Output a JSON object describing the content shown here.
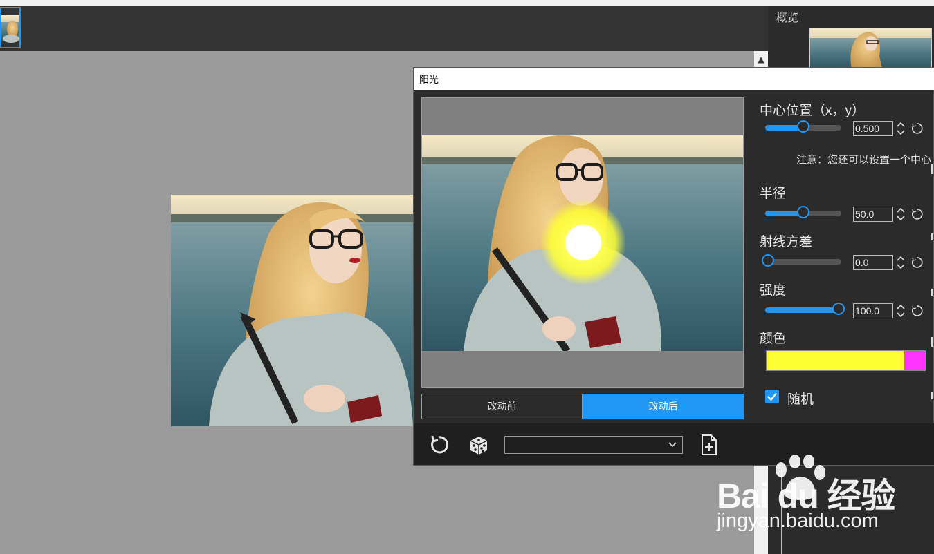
{
  "app": {
    "overview_label": "概览",
    "scroll_up_glyph": "▲"
  },
  "dialog": {
    "title": "阳光",
    "compare_tabs": {
      "before": "改动前",
      "after": "改动后",
      "active": "after"
    },
    "params": {
      "center": {
        "label": "中心位置（x，y）",
        "value": "0.500",
        "slider_fraction": 0.5
      },
      "note": "注意：您还可以设置一个中心",
      "radius": {
        "label": "半径",
        "value": "50.0",
        "slider_fraction": 0.5
      },
      "ray_variance": {
        "label": "射线方差",
        "value": "0.0",
        "slider_fraction": 0.0
      },
      "intensity": {
        "label": "强度",
        "value": "100.0",
        "slider_fraction": 1.0
      },
      "color": {
        "label": "颜色",
        "primary": "#ffff33",
        "secondary": "#ff33ff"
      },
      "random": {
        "label": "随机",
        "checked": true
      }
    },
    "toolbar": {
      "reset_icon": "reset-icon",
      "randomize_icon": "dice-icon",
      "preset_value": "",
      "new_preset_icon": "new-document-icon"
    }
  },
  "watermark": {
    "logo": "Bai du 经验",
    "url": "jingyan.baidu.com"
  },
  "colors": {
    "accent": "#2196f3",
    "dialog_bg": "#2b2b2b",
    "canvas_bg": "#9b9b9b"
  }
}
